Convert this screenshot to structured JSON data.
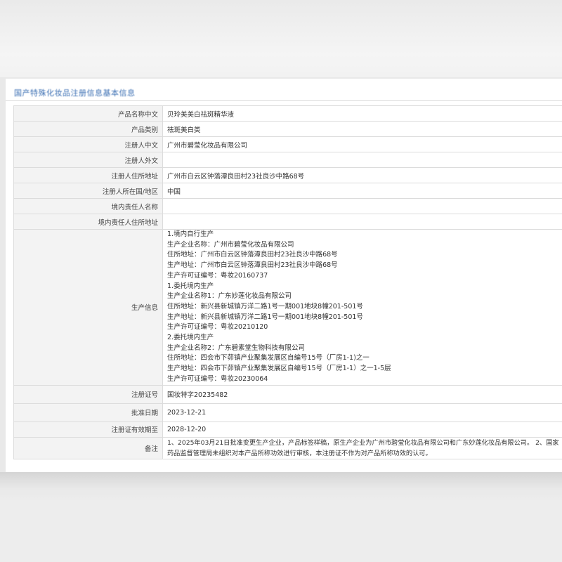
{
  "page_title": "国产特殊化妆品注册信息基本信息",
  "rows": [
    {
      "label": "产品名称中文",
      "value": "贝玲美美白祛斑精华液"
    },
    {
      "label": "产品类别",
      "value": "祛斑美白类"
    },
    {
      "label": "注册人中文",
      "value": "广州市碧莹化妆品有限公司"
    },
    {
      "label": "注册人外文",
      "value": ""
    },
    {
      "label": "注册人住所地址",
      "value": "广州市白云区钟落潭良田村23社良沙中路68号"
    },
    {
      "label": "注册人所在国/地区",
      "value": "中国"
    },
    {
      "label": "境内责任人名称",
      "value": ""
    },
    {
      "label": "境内责任人住所地址",
      "value": ""
    }
  ],
  "production": {
    "label": "生产信息",
    "lines": [
      "1.境内自行生产",
      "生产企业名称：广州市碧莹化妆品有限公司",
      "住所地址：广州市白云区钟落潭良田村23社良沙中路68号",
      "生产地址：广州市白云区钟落潭良田村23社良沙中路68号",
      "生产许可证编号：粤妆20160737",
      "1.委托境内生产",
      "生产企业名称1：广东妙莲化妆品有限公司",
      "住所地址：新兴县新城镇万洋二路1号一期001地块8幢201-501号",
      "生产地址：新兴县新城镇万洋二路1号一期001地块8幢201-501号",
      "生产许可证编号：粤妆20210120",
      "2.委托境内生产",
      "生产企业名称2：广东碧素堂生物科技有限公司",
      "住所地址：四会市下茆镇产业聚集发展区自编号15号（厂房1-1)之一",
      "生产地址：四会市下茆镇产业聚集发展区自编号15号（厂房1-1）之一1-5层",
      "生产许可证编号：粤妆20230064"
    ]
  },
  "rows_after": [
    {
      "label": "注册证号",
      "value": "国妆特字20235482"
    },
    {
      "label": "批准日期",
      "value": "2023-12-21"
    },
    {
      "label": "注册证有效期至",
      "value": "2028-12-20"
    }
  ],
  "remark": {
    "label": "备注",
    "value": "1、2025年03月21日批准变更生产企业，产品标签样稿，原生产企业为广州市碧莹化妆品有限公司和广东妙莲化妆品有限公司。 2、国家药品监督管理局未组织对本产品所称功效进行审核，本注册证不作为对产品所称功效的认可。"
  }
}
